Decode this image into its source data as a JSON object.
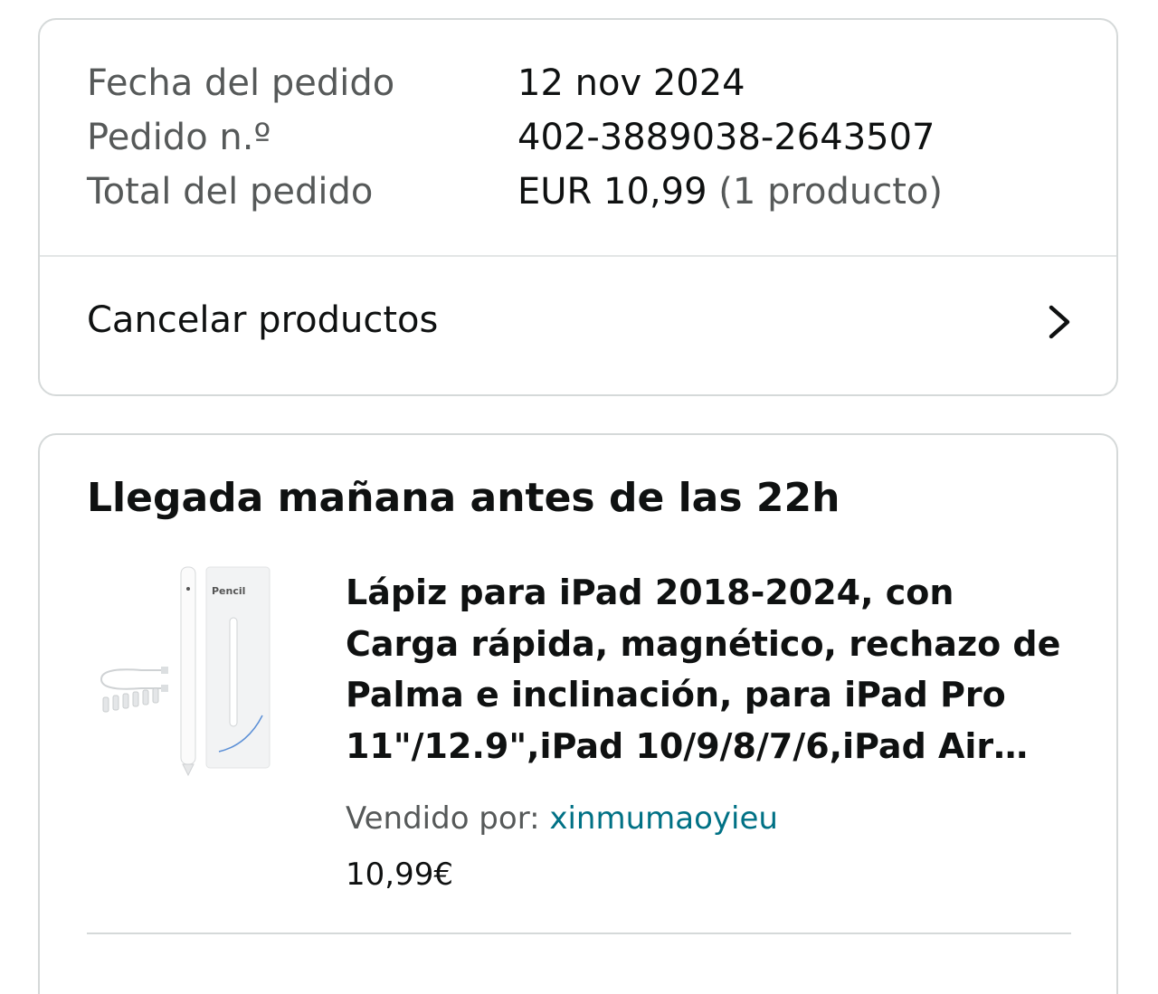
{
  "order_summary": {
    "rows": [
      {
        "label": "Fecha del pedido",
        "value": "12 nov 2024"
      },
      {
        "label": "Pedido n.º",
        "value": "402-3889038-2643507"
      },
      {
        "label": "Total del pedido",
        "value": "EUR 10,99",
        "value_suffix": "(1 producto)"
      }
    ],
    "cancel_label": "Cancelar productos",
    "cancel_icon": "chevron-right-icon"
  },
  "shipment": {
    "title": "Llegada mañana antes de las 22h",
    "product": {
      "image_icon": "stylus-pencil-product-image",
      "image_box_text": "Pencil",
      "title": "Lápiz para iPad 2018-2024, con Carga rápida, magnético, rechazo de Palma e inclinación, para iPad Pro 11\"/12.9\",iPad 10/9/8/7/6,iPad Air…",
      "seller_label": "Vendido por:",
      "seller_name": "xinmumaoyieu",
      "price": "10,99€"
    }
  },
  "colors": {
    "text": "#0f1111",
    "muted_text": "#565959",
    "link": "#007185",
    "border": "#d5d9d9"
  }
}
